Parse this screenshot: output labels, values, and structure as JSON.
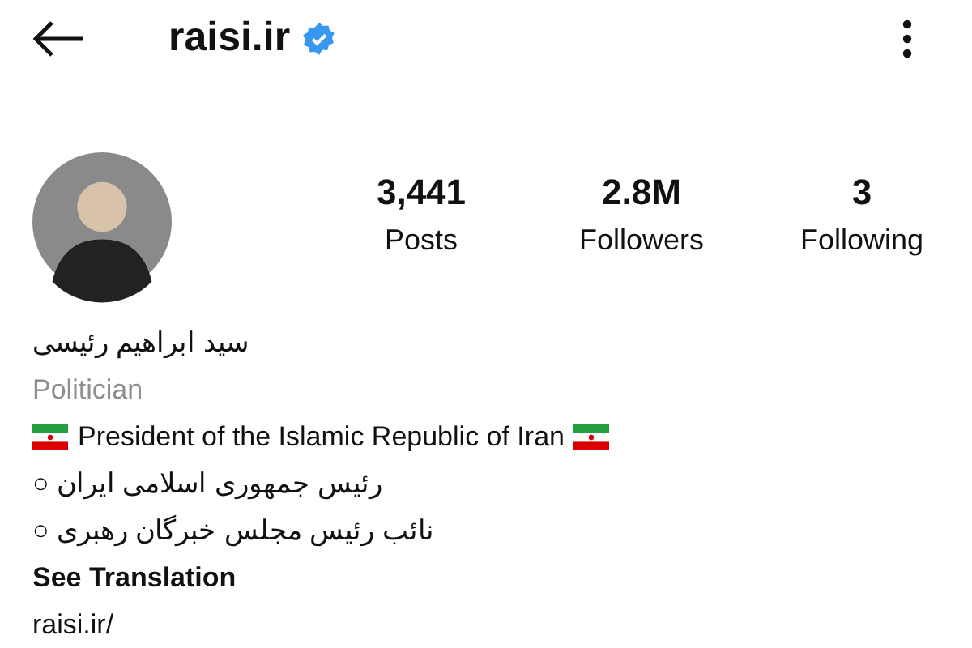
{
  "header": {
    "username": "raisi.ir",
    "verified": true
  },
  "stats": [
    {
      "value": "3,441",
      "label": "Posts"
    },
    {
      "value": "2.8M",
      "label": "Followers"
    },
    {
      "value": "3",
      "label": "Following"
    }
  ],
  "bio": {
    "name": "سید ابراهیم رئیسی",
    "category": "Politician",
    "lines": [
      {
        "kind": "flagged",
        "text": "President of the Islamic Republic of Iran"
      },
      {
        "kind": "rtl",
        "text": "رئیس جمهوری اسلامی ایران ○"
      },
      {
        "kind": "rtl",
        "text": "نائب رئیس مجلس خبرگان رهبری ○"
      }
    ],
    "translate_link": "See Translation",
    "website": "raisi.ir/"
  }
}
